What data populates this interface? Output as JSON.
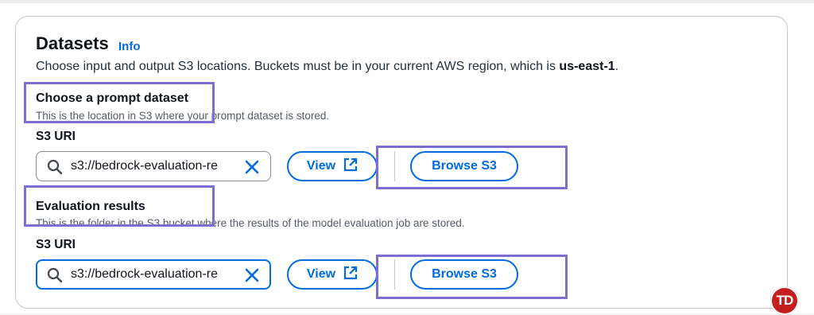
{
  "datasets": {
    "heading": "Datasets",
    "info_link": "Info",
    "description_prefix": "Choose input and output S3 locations. Buckets must be in your current AWS region, which is ",
    "region": "us-east-1",
    "description_suffix": "."
  },
  "prompt_dataset": {
    "title": "Choose a prompt dataset",
    "description": "This is the location in S3 where your prompt dataset is stored.",
    "field_label": "S3 URI",
    "input_value": "s3://bedrock-evaluation-re",
    "view_button": "View",
    "browse_button": "Browse S3"
  },
  "evaluation_results": {
    "title": "Evaluation results",
    "description": "This is the folder in the S3 bucket where the results of the model evaluation job are stored.",
    "field_label": "S3 URI",
    "input_value": "s3://bedrock-evaluation-re",
    "view_button": "View",
    "browse_button": "Browse S3"
  },
  "icons": {
    "search": "search-icon",
    "clear": "close-icon",
    "external": "external-link-icon"
  },
  "colors": {
    "accent": "#006ce0",
    "highlight": "#7b6fd6",
    "badge": "#c41f1f"
  },
  "badge": {
    "text": "TD"
  }
}
